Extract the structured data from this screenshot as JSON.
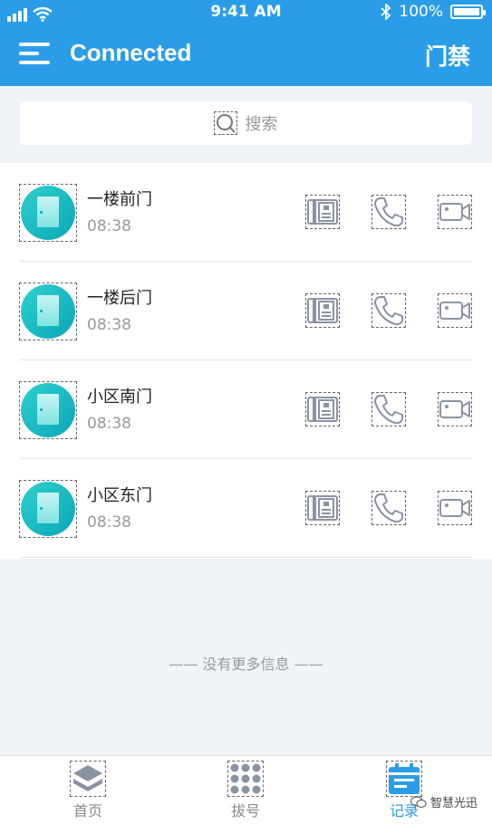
{
  "status_bar": {
    "time": "9:41 AM",
    "battery": "100%"
  },
  "header": {
    "title": "Connected",
    "right_label": "门禁"
  },
  "search": {
    "placeholder": "搜索"
  },
  "doors": [
    {
      "name": "一楼前门",
      "time": "08:38"
    },
    {
      "name": "一楼后门",
      "time": "08:38"
    },
    {
      "name": "小区南门",
      "time": "08:38"
    },
    {
      "name": "小区东门",
      "time": "08:38"
    }
  ],
  "empty_notice": "—— 没有更多信息 ——",
  "tabs": [
    {
      "label": "首页",
      "icon": "layers-icon",
      "active": false
    },
    {
      "label": "拔号",
      "icon": "dialpad-icon",
      "active": false
    },
    {
      "label": "记录",
      "icon": "calendar-icon",
      "active": true
    }
  ],
  "watermark": "智慧光迅",
  "colors": {
    "primary": "#2b9de8",
    "accent_teal": "#1bbcc4",
    "icon_gray": "#8a93a3"
  }
}
